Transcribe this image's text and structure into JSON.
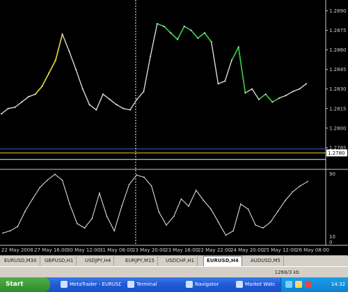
{
  "colors": {
    "background": "#000000",
    "price_line": "#d9d9d9",
    "up_highlight": "#2ecc40",
    "down_highlight": "#e0d81a",
    "blue_line": "#3b5bd6",
    "yellow_line": "#f0d020",
    "white_line": "#f0f0f0",
    "separator": "#c8c8c8",
    "tab_bg": "#d4d0c8",
    "taskbar": "#245edb"
  },
  "main_chart": {
    "y_ticks": [
      "1.2890",
      "1.2875",
      "1.2860",
      "1.2845",
      "1.2830",
      "1.2815",
      "1.2800",
      "1.2785"
    ],
    "current_price_label": "1.2780",
    "price_series": [
      1.2811,
      1.2815,
      1.2816,
      1.282,
      1.2824,
      1.2826,
      1.2832,
      1.2842,
      1.2852,
      1.2872,
      1.2859,
      1.2845,
      1.283,
      1.2818,
      1.2814,
      1.2826,
      1.2822,
      1.2818,
      1.2815,
      1.2814,
      1.2822,
      1.2828,
      1.2855,
      1.288,
      1.2878,
      1.2873,
      1.2868,
      1.2878,
      1.2875,
      1.2869,
      1.2873,
      1.2866,
      1.2834,
      1.2836,
      1.2852,
      1.2862,
      1.2827,
      1.283,
      1.2822,
      1.2826,
      1.282,
      1.2823,
      1.2825,
      1.2828,
      1.283,
      1.2834
    ],
    "highlight_segments": [
      {
        "from": 5,
        "to": 9,
        "color": "down_highlight"
      },
      {
        "from": 23,
        "to": 31,
        "color": "up_highlight"
      },
      {
        "from": 34,
        "to": 36,
        "color": "up_highlight"
      },
      {
        "from": 38,
        "to": 41,
        "color": "up_highlight"
      }
    ],
    "horizontal_lines": [
      {
        "price": 1.2784,
        "color": "blue_line"
      },
      {
        "price": 1.2781,
        "color": "yellow_line"
      },
      {
        "price": 1.2776,
        "color": "white_line"
      }
    ],
    "vertical_marker_index": 19
  },
  "oscillator": {
    "y_top_label": "90",
    "y_bottom_labels": [
      "10",
      "0"
    ],
    "series": [
      15,
      18,
      24,
      45,
      62,
      78,
      88,
      96,
      88,
      55,
      28,
      22,
      35,
      70,
      38,
      18,
      52,
      82,
      95,
      92,
      80,
      44,
      26,
      38,
      62,
      52,
      74,
      60,
      48,
      30,
      12,
      18,
      55,
      48,
      26,
      22,
      30,
      45,
      60,
      72,
      80,
      86
    ]
  },
  "x_axis_labels": [
    "22 May 2008",
    "27 May 16:00",
    "30 May 12:00",
    "31 May 08:00",
    "23 May 20:00",
    "23 May 16:00",
    "22 May 22:00",
    "24 May 20:00",
    "25 May 12:00",
    "26 May 08:00"
  ],
  "tabs": [
    "EURUSD,M30",
    "GBPUSD,H1",
    "USDJPY,H4",
    "EURJPY,M15",
    "USDCHF,H1",
    "EURUSD,H4",
    "AUDUSD,M5"
  ],
  "active_tab_index": 5,
  "statusbar": {
    "right_text": "1268/3 kb"
  },
  "taskbar": {
    "start_label": "Start",
    "buttons": [
      "MetaTrader - EURUSD",
      "Terminal",
      "Navigator",
      "Market Watch"
    ],
    "clock": "14:32"
  }
}
